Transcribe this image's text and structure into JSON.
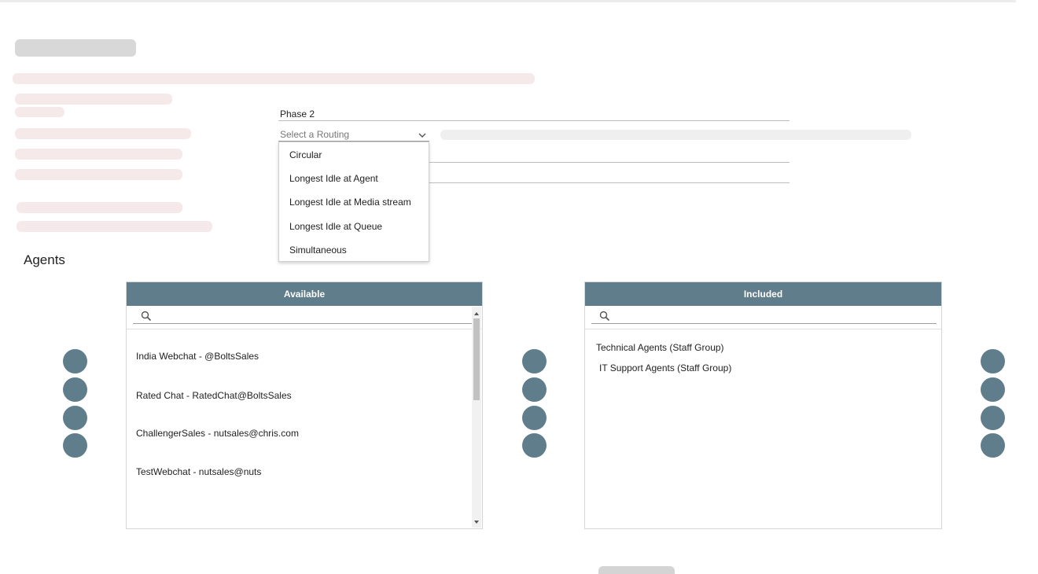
{
  "phase": {
    "label": "Phase 2"
  },
  "routing_select": {
    "placeholder": "Select a Routing",
    "options": [
      "Circular",
      "Longest Idle at Agent",
      "Longest Idle at Media stream",
      "Longest Idle at Queue",
      "Simultaneous"
    ]
  },
  "agents": {
    "title": "Agents",
    "available": {
      "header": "Available",
      "items": [
        "India Webchat - @BoltsSales",
        "Rated Chat - RatedChat@BoltsSales",
        "ChallengerSales - nutsales@chris.com",
        "TestWebchat - nutsales@nuts"
      ]
    },
    "included": {
      "header": "Included",
      "items": [
        "Technical Agents (Staff Group)",
        "IT Support Agents (Staff Group)"
      ]
    }
  },
  "icons": {
    "search": "search-icon",
    "chevron": "chevron-down-icon",
    "scroll_up": "scroll-up-arrow-icon",
    "scroll_down": "scroll-down-arrow-icon"
  },
  "colors": {
    "header": "#607d8b",
    "action_button": "#607d8b",
    "placeholder_pink": "#f6e9e9",
    "placeholder_gray": "#d8d8d8"
  }
}
